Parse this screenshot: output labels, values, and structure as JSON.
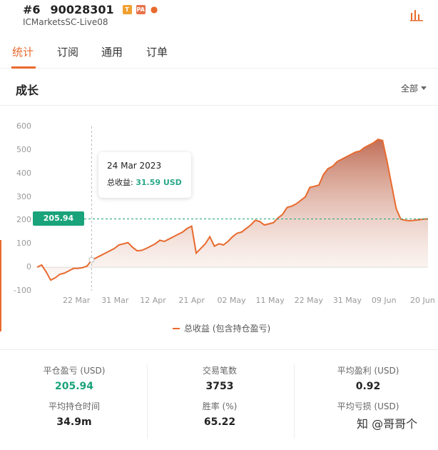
{
  "header": {
    "rank": "#6",
    "account_id": "90028301",
    "badges": [
      "T",
      "PA"
    ],
    "server": "ICMarketsSC-Live08",
    "stats_icon": "bar-chart-icon"
  },
  "tabs": [
    {
      "label": "统计",
      "active": true
    },
    {
      "label": "订阅",
      "active": false
    },
    {
      "label": "通用",
      "active": false
    },
    {
      "label": "订单",
      "active": false
    }
  ],
  "section": {
    "title": "成长",
    "range_label": "全部"
  },
  "tooltip": {
    "date": "24 Mar 2023",
    "label": "总收益: ",
    "value": "31.59 USD"
  },
  "reference": {
    "label": "205.94 USD",
    "value": 205.94
  },
  "chart_data": {
    "type": "area",
    "legend": "总收益 (包含持仓盈亏)",
    "ylim": [
      -100,
      600
    ],
    "yticks": [
      600,
      500,
      400,
      300,
      200,
      100,
      0,
      -100
    ],
    "xticks": [
      "22 Mar",
      "31 Mar",
      "12 Apr",
      "21 Apr",
      "02 May",
      "11 May",
      "22 May",
      "31 May",
      "09 Jun",
      "20 Jun"
    ],
    "grid": false,
    "color": "#e86a2e",
    "reference_line": 205.94,
    "highlight_index": 12,
    "x": [
      0,
      1,
      2,
      3,
      4,
      5,
      6,
      7,
      8,
      9,
      10,
      11,
      12,
      13,
      14,
      15,
      16,
      17,
      18,
      19,
      20,
      21,
      22,
      23,
      24,
      25,
      26,
      27,
      28,
      29,
      30,
      31,
      32,
      33,
      34,
      35,
      36,
      37,
      38,
      39,
      40,
      41,
      42,
      43,
      44,
      45,
      46,
      47,
      48,
      49,
      50,
      51,
      52,
      53,
      54,
      55,
      56,
      57,
      58,
      59,
      60,
      61,
      62,
      63,
      64,
      65,
      66,
      67,
      68,
      69,
      70,
      71,
      72,
      73,
      74,
      75,
      76,
      77,
      78,
      79,
      80,
      81,
      82,
      83,
      84,
      85,
      86,
      87,
      88,
      89,
      90,
      91,
      92,
      93,
      94,
      95,
      96
    ],
    "values": [
      0,
      10,
      -20,
      -55,
      -45,
      -30,
      -25,
      -15,
      -5,
      -5,
      -2,
      5,
      31.59,
      40,
      50,
      60,
      70,
      80,
      95,
      100,
      105,
      85,
      70,
      72,
      80,
      90,
      100,
      115,
      110,
      120,
      130,
      140,
      150,
      165,
      175,
      60,
      80,
      100,
      130,
      90,
      100,
      95,
      110,
      130,
      145,
      150,
      165,
      180,
      200,
      195,
      180,
      185,
      190,
      210,
      225,
      255,
      260,
      270,
      285,
      300,
      340,
      345,
      350,
      395,
      420,
      430,
      450,
      460,
      470,
      480,
      490,
      495,
      510,
      520,
      530,
      545,
      540,
      450,
      350,
      250,
      205,
      200,
      198,
      200,
      202,
      205,
      205.94
    ]
  },
  "stats": [
    {
      "label": "平仓盈亏 (USD)",
      "value": "205.94",
      "green": true
    },
    {
      "label": "交易笔数",
      "value": "3753",
      "green": false
    },
    {
      "label": "平均盈利 (USD)",
      "value": "0.92",
      "green": false
    },
    {
      "label": "平均持仓时间",
      "value": "34.9m",
      "green": false
    },
    {
      "label": "胜率 (%)",
      "value": "65.22",
      "green": false
    },
    {
      "label": "平均亏损 (USD)",
      "value": "",
      "green": false
    }
  ],
  "watermark": "知 @哥哥个"
}
